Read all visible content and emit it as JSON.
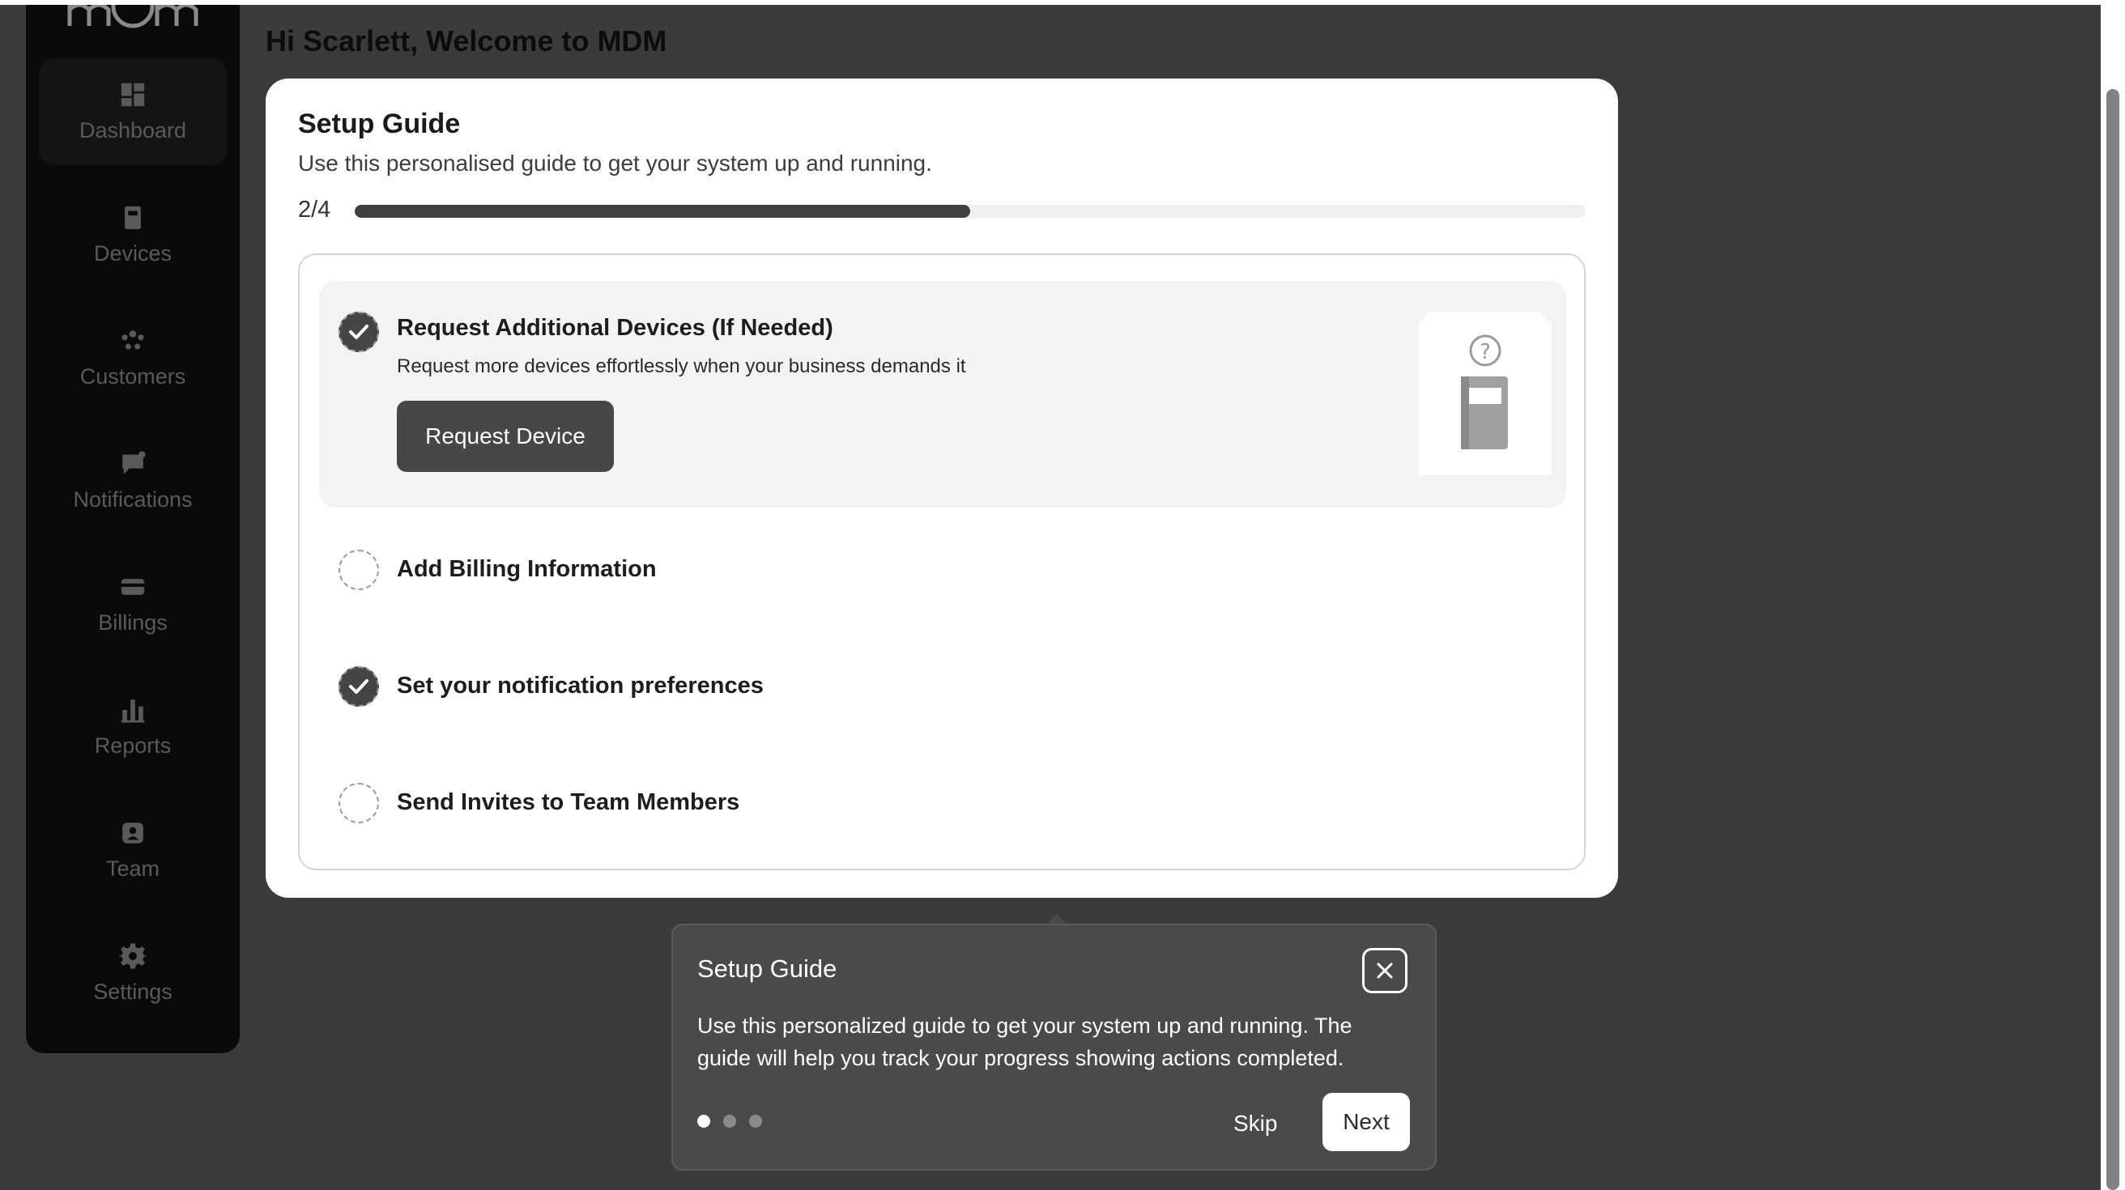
{
  "sidebar": {
    "items": [
      {
        "label": "Dashboard",
        "icon": "dashboard-icon"
      },
      {
        "label": "Devices",
        "icon": "device-icon"
      },
      {
        "label": "Customers",
        "icon": "customers-icon"
      },
      {
        "label": "Notifications",
        "icon": "notifications-icon"
      },
      {
        "label": "Billings",
        "icon": "billing-card-icon"
      },
      {
        "label": "Reports",
        "icon": "bar-chart-icon"
      },
      {
        "label": "Team",
        "icon": "team-badge-icon"
      },
      {
        "label": "Settings",
        "icon": "gear-icon"
      }
    ],
    "active": "Dashboard"
  },
  "header": {
    "welcome": "Hi Scarlett, Welcome to MDM"
  },
  "setup_guide": {
    "title": "Setup Guide",
    "subtitle": "Use this personalised guide to get your system up and running.",
    "progress_label": "2/4",
    "progress_fraction": 0.5,
    "steps": [
      {
        "title": "Request Additional Devices (If Needed)",
        "description": "Request more devices effortlessly when your business demands it",
        "button": "Request Device",
        "done": true
      },
      {
        "title": "Add Billing Information",
        "done": false
      },
      {
        "title": "Set your notification preferences",
        "done": true
      },
      {
        "title": "Send Invites to Team Members",
        "done": false
      }
    ]
  },
  "tooltip": {
    "title": "Setup Guide",
    "body": "Use this personalized guide to get your system up and running. The guide will help you track your progress showing actions completed.",
    "skip": "Skip",
    "next": "Next",
    "page_count": 3,
    "current_page": 1
  },
  "colors": {
    "background": "#3b3b3b",
    "sidebar": "#0a0a0a",
    "accent_dark": "#474747",
    "card": "#ffffff"
  }
}
